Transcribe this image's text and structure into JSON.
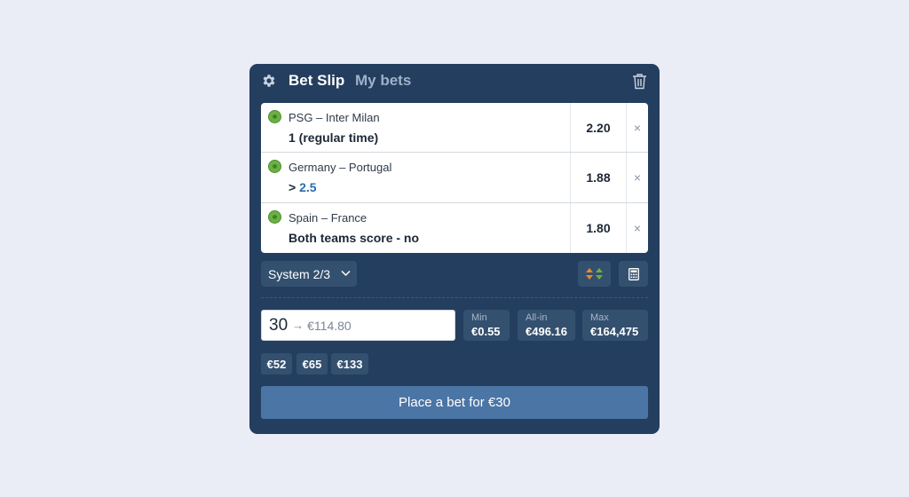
{
  "header": {
    "active_tab": "Bet Slip",
    "inactive_tab": "My bets",
    "settings_icon": "gear-icon",
    "clear_icon": "trash-icon"
  },
  "bets": [
    {
      "match": "PSG – Inter Milan",
      "outcome_prefix": "",
      "outcome": "1 (regular time)",
      "odds": "2.20",
      "sport_icon": "soccer-ball-icon"
    },
    {
      "match": "Germany – Portugal",
      "outcome_prefix": "> ",
      "outcome": "2.5",
      "odds": "1.88",
      "sport_icon": "soccer-ball-icon"
    },
    {
      "match": "Spain – France",
      "outcome_prefix": "",
      "outcome": "Both teams score - no",
      "odds": "1.80",
      "sport_icon": "soccer-ball-icon"
    }
  ],
  "remove_glyph": "×",
  "system": {
    "label": "System 2/3"
  },
  "stake": {
    "value": "30",
    "arrow": "→",
    "potential_return": "€114.80"
  },
  "limits": {
    "min": {
      "label": "Min",
      "amount": "€0.55"
    },
    "all_in": {
      "label": "All-in",
      "amount": "€496.16"
    },
    "max": {
      "label": "Max",
      "amount": "€164,475"
    }
  },
  "quick_stakes": [
    "€52",
    "€65",
    "€133"
  ],
  "place_button": "Place a bet for €30",
  "colors": {
    "panel": "#243e5f",
    "page": "#eaedf6",
    "button": "#4b75a5",
    "chip": "#34506f",
    "highlight": "#2b6cb0",
    "ball": "#6bb043"
  }
}
